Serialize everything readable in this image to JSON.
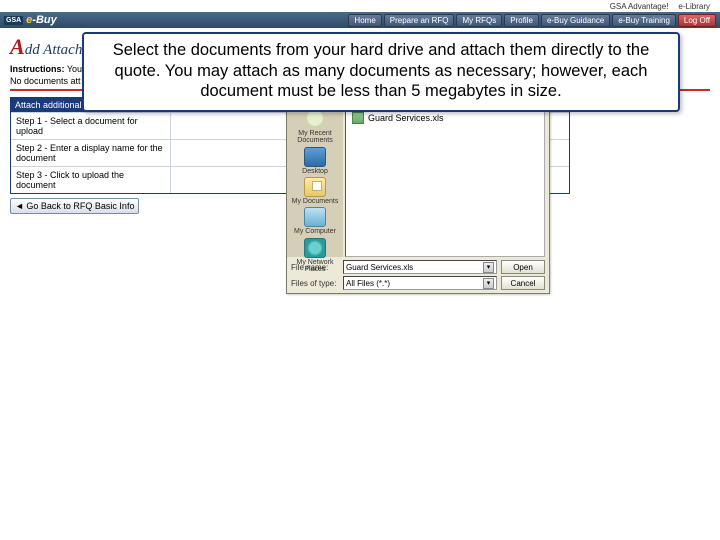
{
  "topbar": {
    "adv": "GSA Advantage!",
    "elib": "e-Library"
  },
  "nav": {
    "home": "Home",
    "prepare": "Prepare an RFQ",
    "myrfqs": "My RFQs",
    "profile": "Profile",
    "guidance": "e-Buy Guidance",
    "training": "e-Buy Training",
    "logoff": "Log Off"
  },
  "logo": {
    "gsa": "GSA",
    "e": "e",
    "buy": "-Buy"
  },
  "page": {
    "title_prefix": "A",
    "title_rest": "dd Attach",
    "instructions_label": "Instructions:",
    "instructions_text": "You",
    "no_docs": "No documents att"
  },
  "attach": {
    "header": "Attach additional documentation",
    "step1": "Step 1 - Select a document for upload",
    "step1_body": "",
    "step2": "Step 2 - Enter a display name for the document",
    "step2_body": "",
    "step3": "Step 3 - Click to upload the document",
    "step3_body": "",
    "goback": "◄ Go Back to RFQ Basic Info"
  },
  "filedlg": {
    "places": {
      "recent": "My Recent Documents",
      "desktop": "Desktop",
      "docs": "My Documents",
      "computer": "My Computer",
      "network": "My Network Places"
    },
    "list_item": "Guard Services.xls",
    "filename_label": "File name:",
    "filename_value": "Guard Services.xls",
    "type_label": "Files of type:",
    "type_value": "All Files (*.*)",
    "open": "Open",
    "cancel": "Cancel"
  },
  "callout": "Select the documents from your hard drive and attach them directly to the quote.  You may attach as many documents as necessary; however, each document must be less than 5 megabytes in size."
}
